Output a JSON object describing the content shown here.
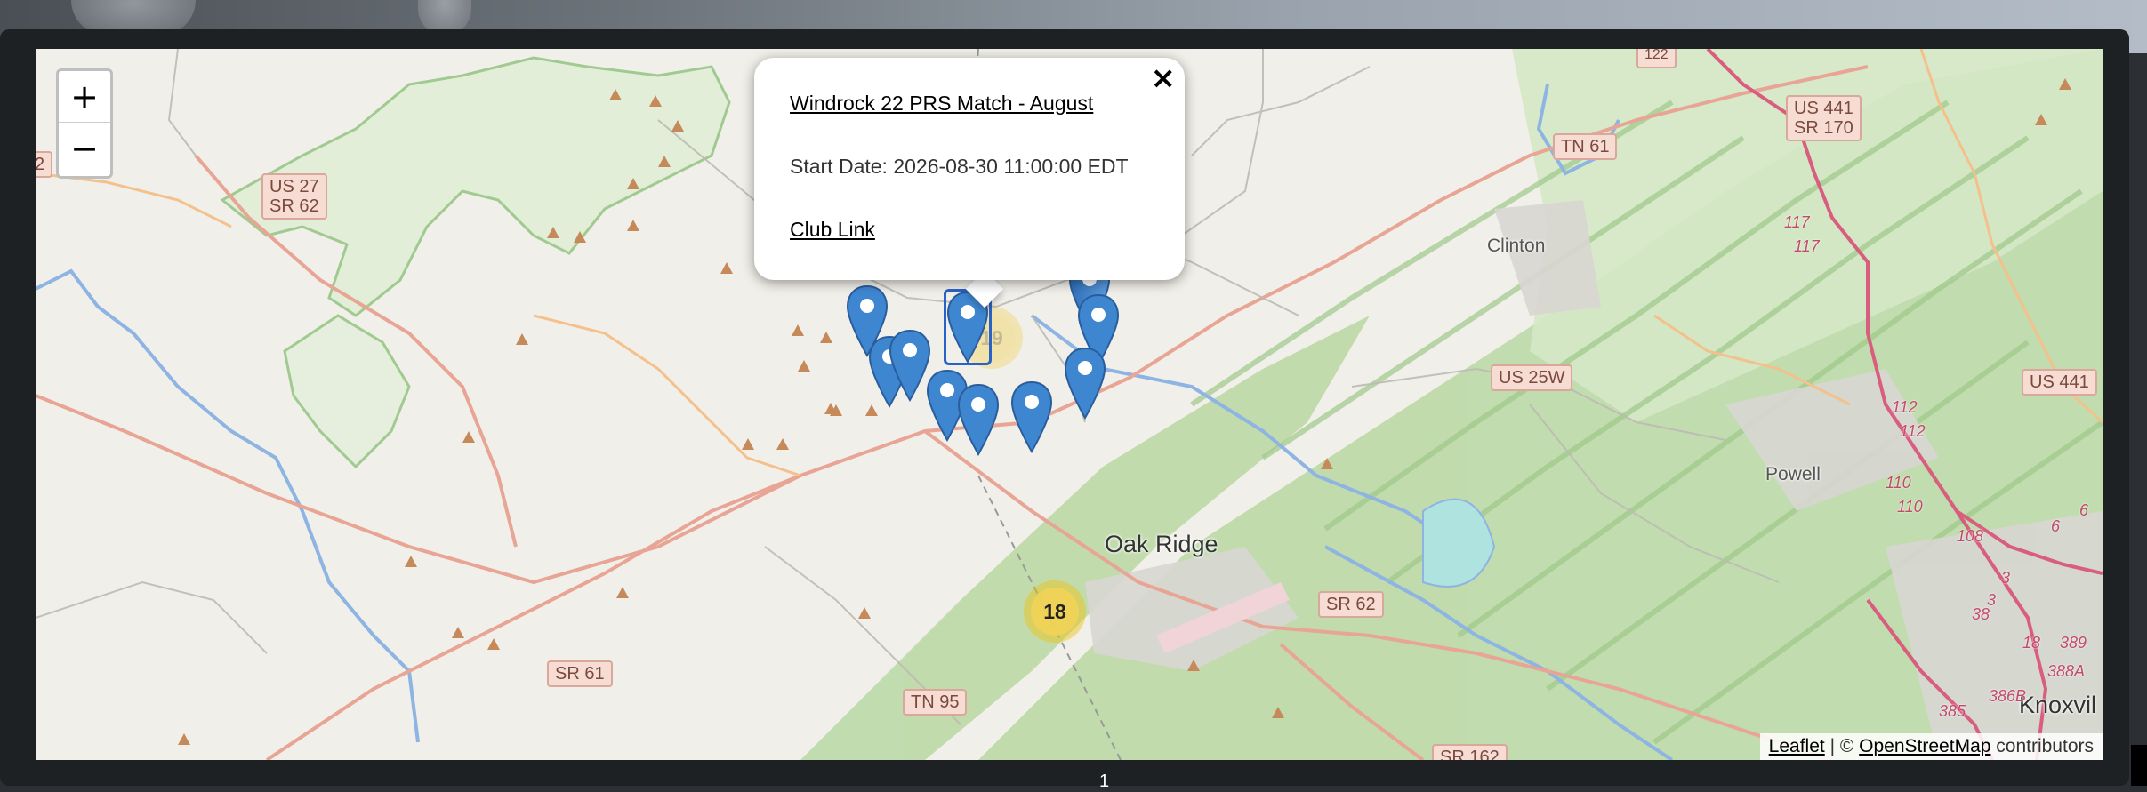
{
  "map": {
    "zoom_in_label": "+",
    "zoom_out_label": "−",
    "cluster_large_count": "18",
    "cluster_hidden_count": "19",
    "road_labels": [
      "US 27\nSR 62",
      "TN 61",
      "US 441\nSR 170",
      "US 25W",
      "US 441",
      "SR 62",
      "SR 61",
      "TN 95",
      "SR 162",
      "2",
      "122"
    ],
    "towns": [
      "Clinton",
      "Powell",
      "Oak Ridge",
      "Knoxvil"
    ],
    "route_numbers": [
      "117",
      "117",
      "112",
      "112",
      "110",
      "110",
      "108",
      "3",
      "3",
      "38",
      "18",
      "389",
      "6",
      "6",
      "388A",
      "386B",
      "385"
    ]
  },
  "popup": {
    "title": "Windrock 22 PRS Match - August",
    "start_date": "Start Date: 2026-08-30 11:00:00 EDT",
    "link_label": "Club Link",
    "close_label": "×"
  },
  "attribution": {
    "leaflet": "Leaflet",
    "separator": " | © ",
    "osm": "OpenStreetMap",
    "suffix": " contributors"
  },
  "page": {
    "bottom_char": "1"
  },
  "colors": {
    "marker_blue": "#3f86d1",
    "cluster_yellow": "#f1d357",
    "road_pink": "#e892a2",
    "forest_green": "#aed29b"
  }
}
